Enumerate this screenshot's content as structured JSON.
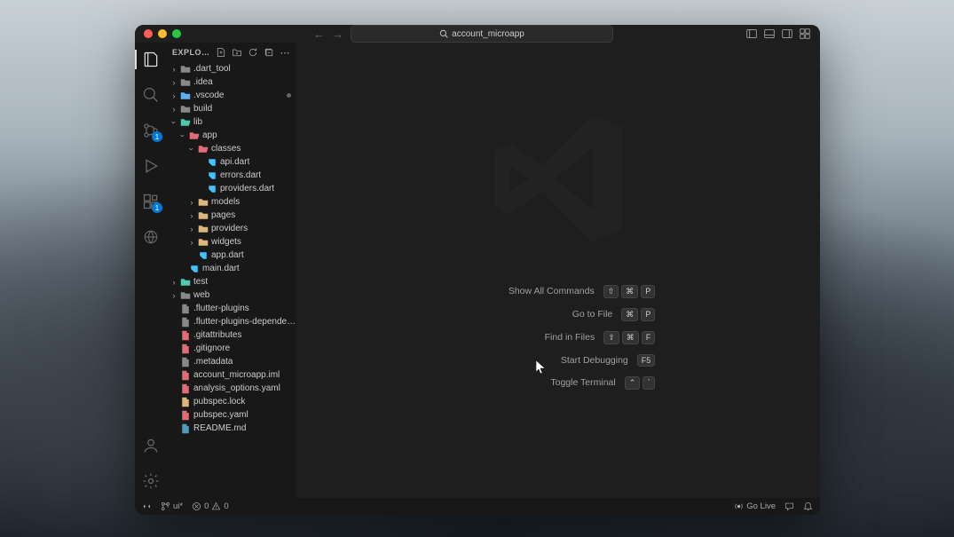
{
  "titlebar": {
    "search_text": "account_microapp"
  },
  "sidebar": {
    "title": "EXPLORE…"
  },
  "tree": [
    {
      "name": ".dart_tool",
      "type": "folder",
      "depth": 0,
      "expanded": false,
      "iconClass": "folder-gray"
    },
    {
      "name": ".idea",
      "type": "folder",
      "depth": 0,
      "expanded": false,
      "iconClass": "folder-gray"
    },
    {
      "name": ".vscode",
      "type": "folder",
      "depth": 0,
      "expanded": false,
      "iconClass": "folder-blue",
      "modified": true
    },
    {
      "name": "build",
      "type": "folder",
      "depth": 0,
      "expanded": false,
      "iconClass": "folder-gray"
    },
    {
      "name": "lib",
      "type": "folder",
      "depth": 0,
      "expanded": true,
      "iconClass": "folder-teal"
    },
    {
      "name": "app",
      "type": "folder",
      "depth": 1,
      "expanded": true,
      "iconClass": "folder-red"
    },
    {
      "name": "classes",
      "type": "folder",
      "depth": 2,
      "expanded": true,
      "iconClass": "folder-red"
    },
    {
      "name": "api.dart",
      "type": "file",
      "depth": 3,
      "iconClass": "file-dart"
    },
    {
      "name": "errors.dart",
      "type": "file",
      "depth": 3,
      "iconClass": "file-dart"
    },
    {
      "name": "providers.dart",
      "type": "file",
      "depth": 3,
      "iconClass": "file-dart"
    },
    {
      "name": "models",
      "type": "folder",
      "depth": 2,
      "expanded": false,
      "iconClass": "folder-yellow"
    },
    {
      "name": "pages",
      "type": "folder",
      "depth": 2,
      "expanded": false,
      "iconClass": "folder-yellow"
    },
    {
      "name": "providers",
      "type": "folder",
      "depth": 2,
      "expanded": false,
      "iconClass": "folder-yellow"
    },
    {
      "name": "widgets",
      "type": "folder",
      "depth": 2,
      "expanded": false,
      "iconClass": "folder-yellow"
    },
    {
      "name": "app.dart",
      "type": "file",
      "depth": 2,
      "iconClass": "file-dart"
    },
    {
      "name": "main.dart",
      "type": "file",
      "depth": 1,
      "iconClass": "file-dart"
    },
    {
      "name": "test",
      "type": "folder",
      "depth": 0,
      "expanded": false,
      "iconClass": "folder-teal"
    },
    {
      "name": "web",
      "type": "folder",
      "depth": 0,
      "expanded": false,
      "iconClass": "folder-gray"
    },
    {
      "name": ".flutter-plugins",
      "type": "file",
      "depth": 0,
      "iconClass": "file-text"
    },
    {
      "name": ".flutter-plugins-dependen…",
      "type": "file",
      "depth": 0,
      "iconClass": "file-text"
    },
    {
      "name": ".gitattributes",
      "type": "file",
      "depth": 0,
      "iconClass": "file-git"
    },
    {
      "name": ".gitignore",
      "type": "file",
      "depth": 0,
      "iconClass": "file-git"
    },
    {
      "name": ".metadata",
      "type": "file",
      "depth": 0,
      "iconClass": "file-text"
    },
    {
      "name": "account_microapp.iml",
      "type": "file",
      "depth": 0,
      "iconClass": "file-xml"
    },
    {
      "name": "analysis_options.yaml",
      "type": "file",
      "depth": 0,
      "iconClass": "file-yaml"
    },
    {
      "name": "pubspec.lock",
      "type": "file",
      "depth": 0,
      "iconClass": "file-lock"
    },
    {
      "name": "pubspec.yaml",
      "type": "file",
      "depth": 0,
      "iconClass": "file-yaml"
    },
    {
      "name": "README.md",
      "type": "file",
      "depth": 0,
      "iconClass": "file-md"
    }
  ],
  "welcome": {
    "shortcuts": [
      {
        "label": "Show All Commands",
        "keys": [
          "⇧",
          "⌘",
          "P"
        ]
      },
      {
        "label": "Go to File",
        "keys": [
          "⌘",
          "P"
        ]
      },
      {
        "label": "Find in Files",
        "keys": [
          "⇧",
          "⌘",
          "F"
        ]
      },
      {
        "label": "Start Debugging",
        "keys": [
          "F5"
        ]
      },
      {
        "label": "Toggle Terminal",
        "keys": [
          "⌃",
          "`"
        ]
      }
    ]
  },
  "statusbar": {
    "branch": "ui*",
    "errors": "0",
    "warnings": "0",
    "golive": "Go Live"
  },
  "activity_badges": {
    "scm": "1",
    "ext": "1"
  }
}
